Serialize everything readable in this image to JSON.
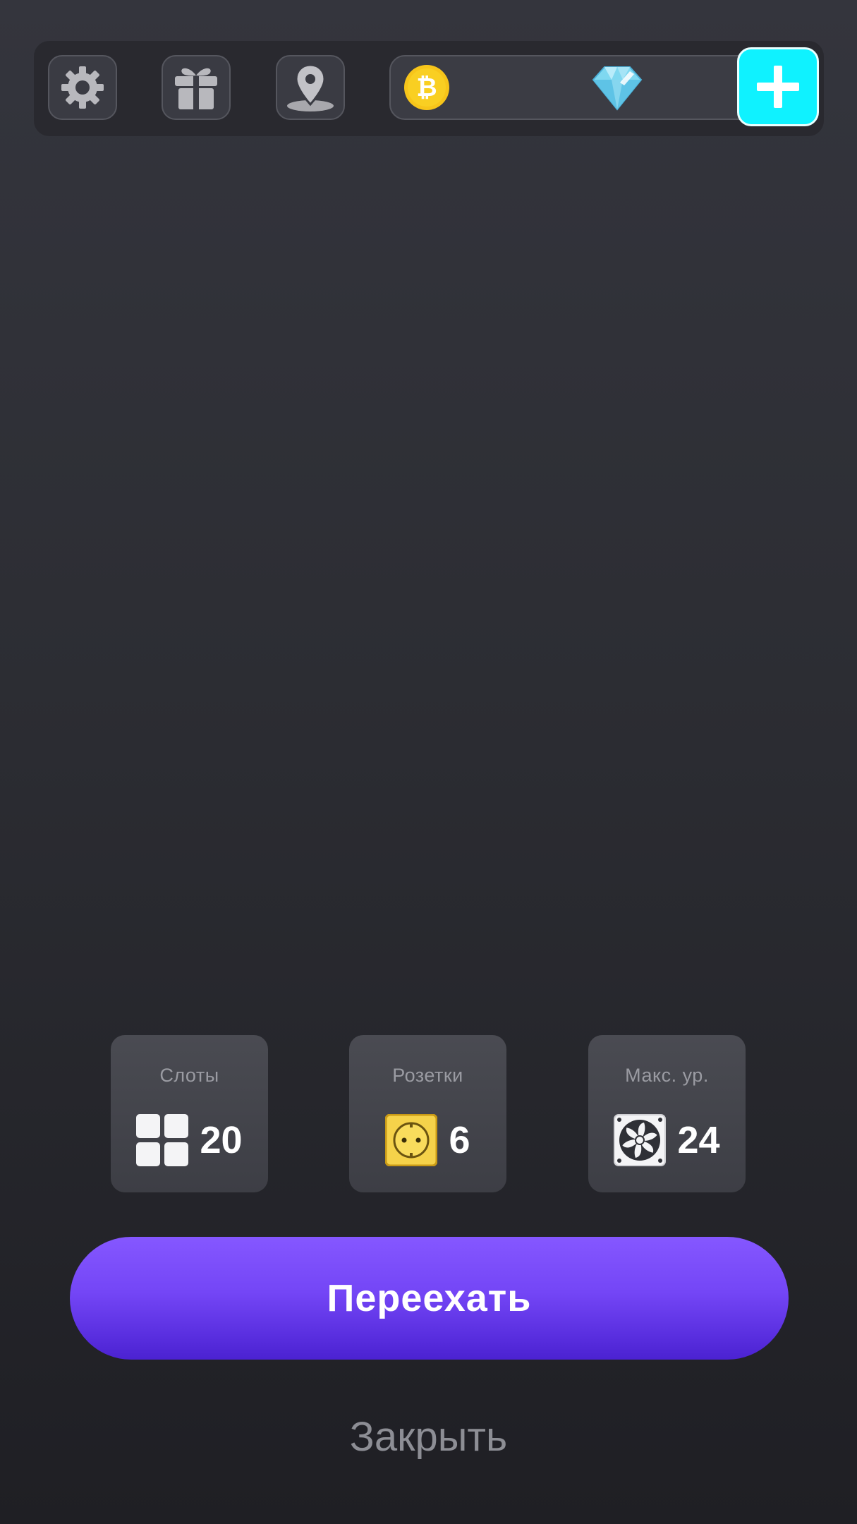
{
  "topbar": {
    "icons": {
      "settings": "gear-icon",
      "gift": "gift-icon",
      "location": "map-pin-icon",
      "coin": "bitcoin-icon",
      "gem": "diamond-icon",
      "add": "plus-icon"
    },
    "coin_value": "",
    "gem_value": ""
  },
  "stats": [
    {
      "label": "Слоты",
      "value": "20",
      "icon": "grid-icon"
    },
    {
      "label": "Розетки",
      "value": "6",
      "icon": "power-socket-icon"
    },
    {
      "label": "Макс. ур.",
      "value": "24",
      "icon": "fan-icon"
    }
  ],
  "actions": {
    "move_label": "Переехать",
    "close_label": "Закрыть"
  },
  "colors": {
    "background": "#2c2d33",
    "accent_cyan": "#0ff2ff",
    "button_purple": "#7446f6",
    "coin_yellow": "#f7c51a",
    "socket_yellow": "#f5d24a"
  }
}
